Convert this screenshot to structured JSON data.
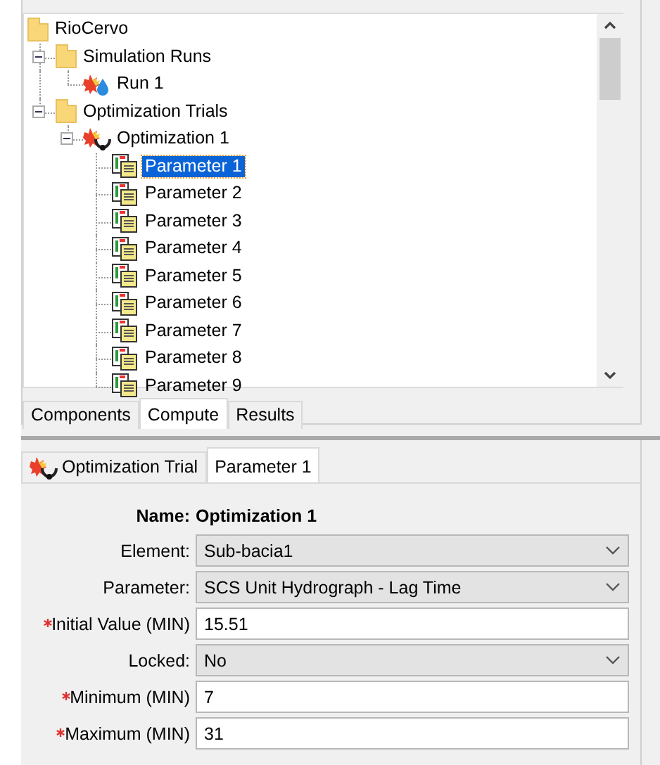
{
  "tree": [
    {
      "label": "RioCervo",
      "kind": "folder",
      "selected": false,
      "children": [
        {
          "label": "Simulation Runs",
          "kind": "folder",
          "selected": false,
          "expanded": true,
          "children": [
            {
              "label": "Run 1",
              "kind": "run",
              "selected": false
            }
          ]
        },
        {
          "label": "Optimization Trials",
          "kind": "folder",
          "selected": false,
          "expanded": true,
          "children": [
            {
              "label": "Optimization 1",
              "kind": "trial",
              "selected": false,
              "expanded": true,
              "children": [
                {
                  "label": "Parameter 1",
                  "kind": "parameter",
                  "selected": true
                },
                {
                  "label": "Parameter 2",
                  "kind": "parameter",
                  "selected": false
                },
                {
                  "label": "Parameter 3",
                  "kind": "parameter",
                  "selected": false
                },
                {
                  "label": "Parameter 4",
                  "kind": "parameter",
                  "selected": false
                },
                {
                  "label": "Parameter 5",
                  "kind": "parameter",
                  "selected": false
                },
                {
                  "label": "Parameter 6",
                  "kind": "parameter",
                  "selected": false
                },
                {
                  "label": "Parameter 7",
                  "kind": "parameter",
                  "selected": false
                },
                {
                  "label": "Parameter 8",
                  "kind": "parameter",
                  "selected": false
                },
                {
                  "label": "Parameter 9",
                  "kind": "parameter",
                  "selected": false
                }
              ]
            }
          ]
        }
      ]
    }
  ],
  "explorer_tabs": [
    {
      "label": "Components",
      "selected": false
    },
    {
      "label": "Compute",
      "selected": true
    },
    {
      "label": "Results",
      "selected": false
    }
  ],
  "editor_tabs": [
    {
      "label": "Optimization Trial",
      "kind": "trial",
      "selected": false
    },
    {
      "label": "Parameter 1",
      "selected": true
    }
  ],
  "form": {
    "name_label": "Name:",
    "name_value": "Optimization 1",
    "fields": [
      {
        "label": "Element:",
        "kind": "dropdown",
        "required": false,
        "value": "Sub-bacia1"
      },
      {
        "label": "Parameter:",
        "kind": "dropdown",
        "required": false,
        "value": "SCS Unit Hydrograph - Lag Time"
      },
      {
        "label": "Initial Value (MIN)",
        "kind": "text",
        "required": true,
        "value": "15.51"
      },
      {
        "label": "Locked:",
        "kind": "dropdown",
        "required": false,
        "value": "No"
      },
      {
        "label": "Minimum (MIN)",
        "kind": "text",
        "required": true,
        "value": "7"
      },
      {
        "label": "Maximum (MIN)",
        "kind": "text",
        "required": true,
        "value": "31"
      }
    ]
  }
}
